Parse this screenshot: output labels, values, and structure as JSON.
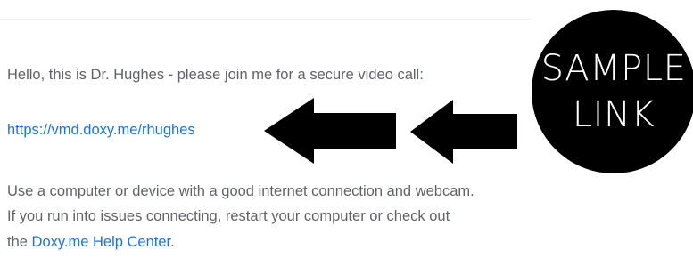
{
  "email": {
    "greeting": "Hello, this is Dr. Hughes - please join me for a secure video call:",
    "call_link": "https://vmd.doxy.me/rhughes",
    "instructions_line1": "Use a computer or device with a good internet connection and webcam.",
    "instructions_line2": "If you run into issues connecting, restart your computer or check out",
    "instructions_line3_prefix": "the ",
    "help_link": "Doxy.me Help Center",
    "instructions_line3_suffix": "."
  },
  "annotation": {
    "badge_line1": "SAMPLE",
    "badge_line2": "LINK",
    "arrow_icon_1": "left-arrow-icon",
    "arrow_icon_2": "left-arrow-icon"
  },
  "colors": {
    "text": "#5f6368",
    "link": "#1a73e8",
    "badge_background": "#000000",
    "badge_text": "#ffffff"
  }
}
